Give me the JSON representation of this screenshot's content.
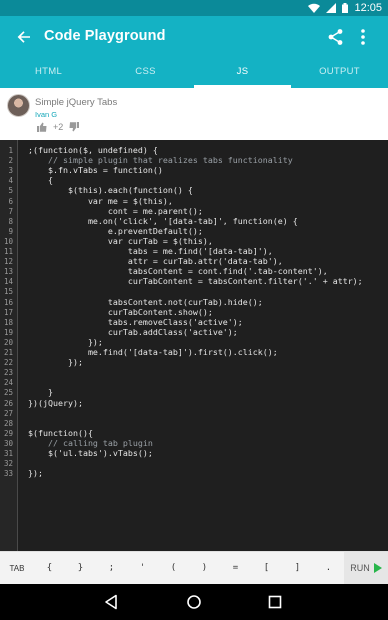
{
  "status_bar": {
    "time": "12:05"
  },
  "app_bar": {
    "title": "Code Playground"
  },
  "tabs": [
    {
      "label": "HTML",
      "active": false
    },
    {
      "label": "CSS",
      "active": false
    },
    {
      "label": "JS",
      "active": true
    },
    {
      "label": "OUTPUT",
      "active": false
    }
  ],
  "snippet": {
    "title": "Simple jQuery Tabs",
    "author": "Ivan G",
    "votes": "+2"
  },
  "code": {
    "line_numbers": [
      "1",
      "2",
      "3",
      "4",
      "5",
      "6",
      "7",
      "8",
      "9",
      "10",
      "11",
      "12",
      "13",
      "14",
      "15",
      "16",
      "17",
      "18",
      "19",
      "20",
      "21",
      "22",
      "23",
      "24",
      "25",
      "26",
      "27",
      "28",
      "29",
      "30",
      "31",
      "32",
      "33"
    ],
    "lines": [
      ";(function($, undefined) {",
      "    // simple plugin that realizes tabs functionality",
      "    $.fn.vTabs = function()",
      "    {",
      "        $(this).each(function() {",
      "            var me = $(this),",
      "                cont = me.parent();",
      "            me.on('click', '[data-tab]', function(e) {",
      "                e.preventDefault();",
      "                var curTab = $(this),",
      "                    tabs = me.find('[data-tab]'),",
      "                    attr = curTab.attr('data-tab'),",
      "                    tabsContent = cont.find('.tab-content'),",
      "                    curTabContent = tabsContent.filter('.' + attr);",
      "",
      "                tabsContent.not(curTab).hide();",
      "                curTabContent.show();",
      "                tabs.removeClass('active');",
      "                curTab.addClass('active');",
      "            });",
      "            me.find('[data-tab]').first().click();",
      "        });",
      "",
      "",
      "    }",
      "})(jQuery);",
      "",
      "",
      "$(function(){",
      "    // calling tab plugin",
      "    $('ul.tabs').vTabs();",
      "",
      "});"
    ]
  },
  "keybar": {
    "keys": [
      "TAB",
      "{",
      "}",
      ";",
      "'",
      "(",
      ")",
      "=",
      "[",
      "]",
      "."
    ],
    "run_label": "RUN"
  },
  "colors": {
    "status_bar": "#0b8a99",
    "app_bar": "#14b2c4",
    "editor_bg": "#1f1f1f",
    "run_icon": "#27b54a"
  },
  "icons": {
    "back": "arrow-left-icon",
    "share": "share-icon",
    "more": "more-vert-icon",
    "thumb_up": "thumb-up-icon",
    "thumb_down": "thumb-down-icon",
    "run": "play-icon"
  }
}
